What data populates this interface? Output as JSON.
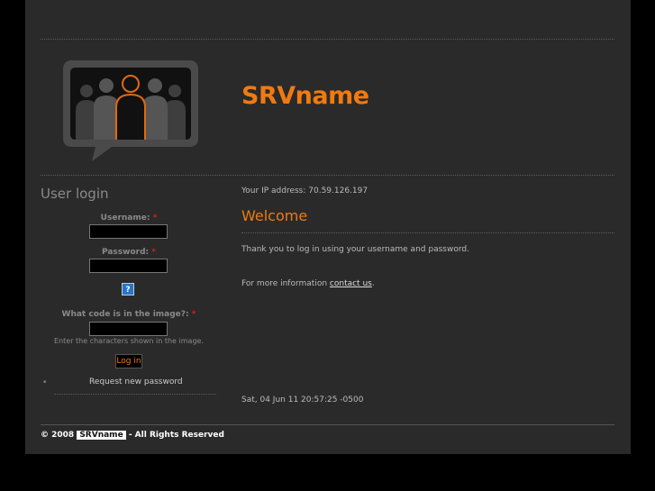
{
  "header": {
    "site_name": "SRVname",
    "logo_icon": "crowd-speech-bubble-icon"
  },
  "sidebar": {
    "title": "User login",
    "username_label": "Username:",
    "password_label": "Password:",
    "required_mark": "*",
    "help_icon": "?",
    "captcha_label": "What code is in the image?:",
    "captcha_description": "Enter the characters shown in the image.",
    "login_button": "Log in",
    "bullet": "•",
    "request_password_link": "Request new password"
  },
  "main": {
    "ip_text": "Your IP address: 70.59.126.197",
    "welcome_title": "Welcome",
    "thank_you_text": "Thank you to log in using your username and password.",
    "more_info_prefix": "For more information ",
    "contact_link": "contact us",
    "more_info_suffix": ".",
    "timestamp": "Sat, 04 Jun 11 20:57:25 -0500"
  },
  "footer": {
    "prefix": "© 2008",
    "brand": "SRVname",
    "suffix": "- All Rights Reserved"
  },
  "colors": {
    "accent": "#f07a10",
    "background": "#2a2a2a",
    "outer": "#000000"
  }
}
